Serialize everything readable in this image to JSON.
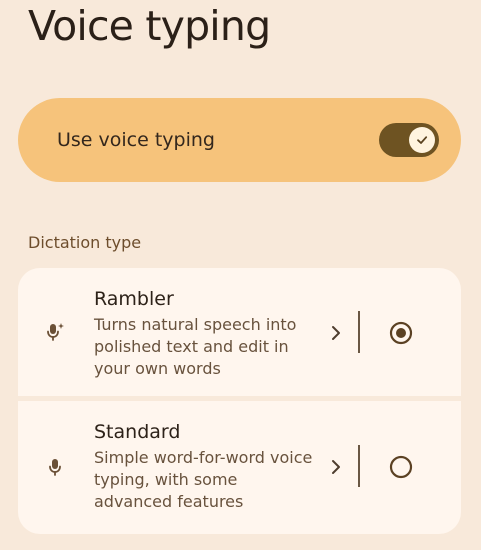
{
  "header": {
    "title": "Voice typing"
  },
  "voice_typing": {
    "label": "Use voice typing",
    "enabled": true
  },
  "dictation": {
    "section_label": "Dictation type",
    "options": [
      {
        "title": "Rambler",
        "description": "Turns natural speech into polished text and edit in your own words",
        "icon": "sparkle-microphone-icon",
        "selected": true
      },
      {
        "title": "Standard",
        "description": "Simple word-for-word voice typing, with some advanced features",
        "icon": "microphone-icon",
        "selected": false
      }
    ]
  },
  "colors": {
    "background": "#f8e9da",
    "toggle_card": "#f6c37b",
    "switch_track": "#6e5322",
    "option_card": "#fff6ee",
    "primary_text": "#2f241b",
    "secondary_text": "#68523d"
  }
}
